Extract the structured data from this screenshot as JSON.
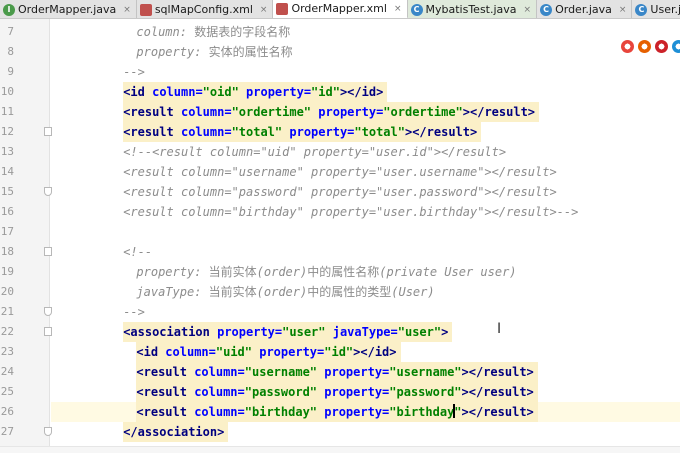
{
  "tabs": [
    {
      "label": "OrderMapper.java",
      "icon": "interface-icon",
      "color": "#4a9a4a",
      "active": false
    },
    {
      "label": "sqlMapConfig.xml",
      "icon": "xml-icon",
      "color": "#c0504d",
      "active": false
    },
    {
      "label": "OrderMapper.xml",
      "icon": "xml-icon",
      "color": "#c0504d",
      "active": true
    },
    {
      "label": "MybatisTest.java",
      "icon": "class-icon",
      "color": "#3a87c8",
      "active": false
    },
    {
      "label": "Order.java",
      "icon": "class-icon",
      "color": "#3a87c8",
      "active": false
    },
    {
      "label": "User.java",
      "icon": "class-icon",
      "color": "#3a87c8",
      "active": false
    }
  ],
  "lines": [
    {
      "num": "7",
      "indent": "        ",
      "parts": [
        [
          "c",
          "column: "
        ],
        [
          "k",
          "数据表的字段名称"
        ]
      ]
    },
    {
      "num": "8",
      "indent": "        ",
      "parts": [
        [
          "c",
          "property: "
        ],
        [
          "k",
          "实体的属性名称"
        ]
      ]
    },
    {
      "num": "9",
      "indent": "    ",
      "parts": [
        [
          "c",
          "-->"
        ]
      ]
    },
    {
      "num": "10",
      "indent": "    ",
      "hl": true,
      "parts": [
        [
          "t",
          "<id "
        ],
        [
          "a",
          "column="
        ],
        [
          "v",
          "\"oid\""
        ],
        [
          "a",
          " property="
        ],
        [
          "v",
          "\"id\""
        ],
        [
          "t",
          "></id>"
        ]
      ]
    },
    {
      "num": "11",
      "indent": "    ",
      "hl": true,
      "parts": [
        [
          "t",
          "<result "
        ],
        [
          "a",
          "column="
        ],
        [
          "v",
          "\"ordertime\""
        ],
        [
          "a",
          " property="
        ],
        [
          "v",
          "\"ordertime\""
        ],
        [
          "t",
          "></result>"
        ]
      ]
    },
    {
      "num": "12",
      "indent": "    ",
      "hl": true,
      "parts": [
        [
          "t",
          "<result "
        ],
        [
          "a",
          "column="
        ],
        [
          "v",
          "\"total\""
        ],
        [
          "a",
          " property="
        ],
        [
          "v",
          "\"total\""
        ],
        [
          "t",
          "></result>"
        ]
      ]
    },
    {
      "num": "13",
      "indent": "    ",
      "parts": [
        [
          "c",
          "<!--<result column=\"uid\" property=\"user.id\"></result>"
        ]
      ]
    },
    {
      "num": "14",
      "indent": "    ",
      "parts": [
        [
          "c",
          "<result column=\"username\" property=\"user.username\"></result>"
        ]
      ]
    },
    {
      "num": "15",
      "indent": "    ",
      "parts": [
        [
          "c",
          "<result column=\"password\" property=\"user.password\"></result>"
        ]
      ]
    },
    {
      "num": "16",
      "indent": "    ",
      "parts": [
        [
          "c",
          "<result column=\"birthday\" property=\"user.birthday\"></result>-->"
        ]
      ]
    },
    {
      "num": "17",
      "indent": "",
      "parts": []
    },
    {
      "num": "18",
      "indent": "    ",
      "parts": [
        [
          "c",
          "<!--"
        ]
      ]
    },
    {
      "num": "19",
      "indent": "        ",
      "parts": [
        [
          "c",
          "property: "
        ],
        [
          "k",
          "当前实体"
        ],
        [
          "c",
          "(order)"
        ],
        [
          "k",
          "中的属性名称"
        ],
        [
          "c",
          "(private User user)"
        ]
      ]
    },
    {
      "num": "20",
      "indent": "        ",
      "parts": [
        [
          "c",
          "javaType: "
        ],
        [
          "k",
          "当前实体"
        ],
        [
          "c",
          "(order)"
        ],
        [
          "k",
          "中的属性的类型"
        ],
        [
          "c",
          "(User)"
        ]
      ]
    },
    {
      "num": "21",
      "indent": "    ",
      "parts": [
        [
          "c",
          "-->"
        ]
      ]
    },
    {
      "num": "22",
      "indent": "    ",
      "hl": true,
      "parts": [
        [
          "t",
          "<association "
        ],
        [
          "a",
          "property="
        ],
        [
          "v",
          "\"user\""
        ],
        [
          "a",
          " javaType="
        ],
        [
          "v",
          "\"user\""
        ],
        [
          "t",
          ">"
        ]
      ]
    },
    {
      "num": "23",
      "indent": "        ",
      "hl": true,
      "parts": [
        [
          "t",
          "<id "
        ],
        [
          "a",
          "column="
        ],
        [
          "v",
          "\"uid\""
        ],
        [
          "a",
          " property="
        ],
        [
          "v",
          "\"id\""
        ],
        [
          "t",
          "></id>"
        ]
      ]
    },
    {
      "num": "24",
      "indent": "        ",
      "hl": true,
      "parts": [
        [
          "t",
          "<result "
        ],
        [
          "a",
          "column="
        ],
        [
          "v",
          "\"username\""
        ],
        [
          "a",
          " property="
        ],
        [
          "v",
          "\"username\""
        ],
        [
          "t",
          "></result>"
        ]
      ]
    },
    {
      "num": "25",
      "indent": "        ",
      "hl": true,
      "parts": [
        [
          "t",
          "<result "
        ],
        [
          "a",
          "column="
        ],
        [
          "v",
          "\"password\""
        ],
        [
          "a",
          " property="
        ],
        [
          "v",
          "\"password\""
        ],
        [
          "t",
          "></result>"
        ]
      ]
    },
    {
      "num": "26",
      "indent": "        ",
      "hl": true,
      "caret": true,
      "parts": [
        [
          "t",
          "<result "
        ],
        [
          "a",
          "column="
        ],
        [
          "v",
          "\"birthday\""
        ],
        [
          "a",
          " property="
        ],
        [
          "v",
          "\"birthday"
        ],
        [
          "cursor",
          ""
        ],
        [
          "v",
          "\""
        ],
        [
          "t",
          "></result>"
        ]
      ]
    },
    {
      "num": "27",
      "indent": "    ",
      "hl": true,
      "parts": [
        [
          "t",
          "</association>"
        ]
      ]
    }
  ],
  "folds": {
    "5": "start",
    "8": "end",
    "11": "start",
    "14": "end",
    "15": "start",
    "20": "end"
  },
  "browsers": [
    {
      "name": "chrome-icon",
      "color": "#e8453c"
    },
    {
      "name": "firefox-icon",
      "color": "#e66000"
    },
    {
      "name": "opera-icon",
      "color": "#cc2229"
    },
    {
      "name": "ie-icon",
      "color": "#1e8fd6"
    }
  ]
}
